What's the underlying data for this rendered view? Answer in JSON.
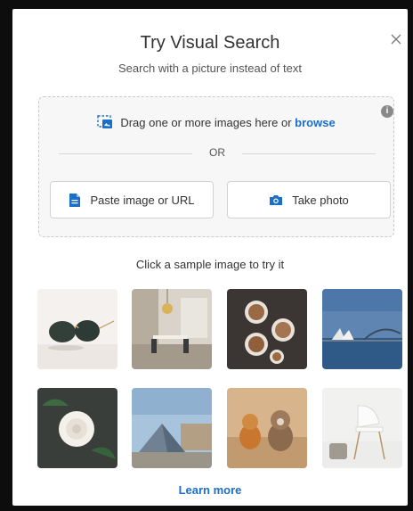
{
  "dialog": {
    "title": "Try Visual Search",
    "subtitle": "Search with a picture instead of text"
  },
  "dropzone": {
    "drag_text": "Drag one or more images here or",
    "browse_link": "browse",
    "or_text": "OR",
    "paste_button": "Paste image or URL",
    "photo_button": "Take photo"
  },
  "samples": {
    "label": "Click a sample image to try it",
    "items": [
      {
        "name": "sunglasses"
      },
      {
        "name": "dining-room"
      },
      {
        "name": "coffee-cups"
      },
      {
        "name": "sydney-opera-house"
      },
      {
        "name": "white-rose"
      },
      {
        "name": "louvre-pyramid"
      },
      {
        "name": "dogs"
      },
      {
        "name": "white-chair"
      }
    ]
  },
  "footer": {
    "learn_more": "Learn more"
  },
  "colors": {
    "link": "#1a6fc9",
    "icon_blue": "#1a6fc9"
  }
}
